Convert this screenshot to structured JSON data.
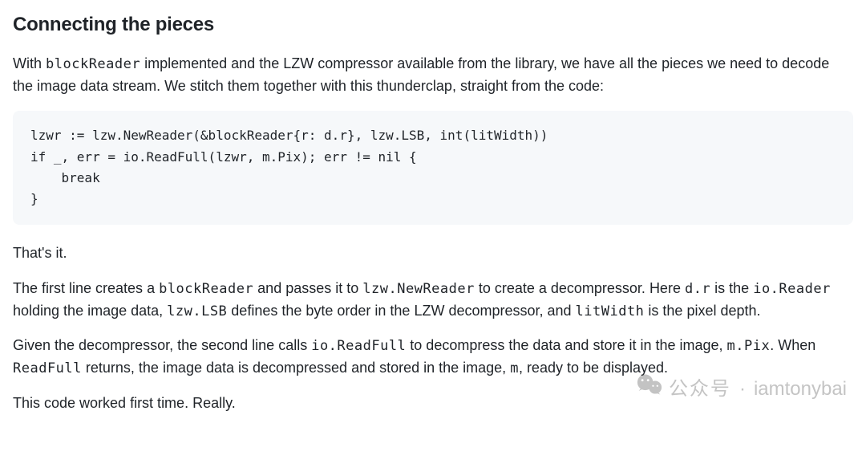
{
  "heading": "Connecting the pieces",
  "intro": {
    "t1": "With ",
    "c1": "blockReader",
    "t2": " implemented and the LZW compressor available from the library, we have all the pieces we need to decode the image data stream. We stitch them together with this thunderclap, straight from the code:"
  },
  "code": "lzwr := lzw.NewReader(&blockReader{r: d.r}, lzw.LSB, int(litWidth))\nif _, err = io.ReadFull(lzwr, m.Pix); err != nil {\n    break\n}",
  "thats_it": "That's it.",
  "p2": {
    "t1": "The first line creates a ",
    "c1": "blockReader",
    "t2": " and passes it to ",
    "c2": "lzw.NewReader",
    "t3": " to create a decompressor. Here ",
    "c3": "d.r",
    "t4": " is the ",
    "c4": "io.Reader",
    "t5": " holding the image data, ",
    "c5": "lzw.LSB",
    "t6": " defines the byte order in the LZW decompressor, and ",
    "c6": "litWidth",
    "t7": " is the pixel depth."
  },
  "p3": {
    "t1": "Given the decompressor, the second line calls ",
    "c1": "io.ReadFull",
    "t2": " to decompress the data and store it in the image, ",
    "c2": "m.Pix",
    "t3": ". When ",
    "c3": "ReadFull",
    "t4": " returns, the image data is decompressed and stored in the image, ",
    "c4": "m",
    "t5": ", ready to be displayed."
  },
  "p4": "This code worked first time. Really.",
  "watermark": {
    "cn": "公众号",
    "dot": "·",
    "handle": "iamtonybai"
  }
}
